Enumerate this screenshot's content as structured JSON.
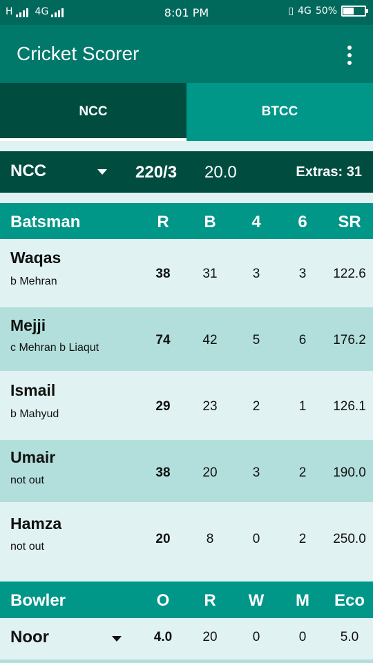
{
  "status_bar": {
    "network_left": "H",
    "network_mid": "4G",
    "time": "8:01 PM",
    "network_right": "4G",
    "battery": "50%",
    "battery_level": 0.5
  },
  "app": {
    "title": "Cricket Scorer",
    "menu_icon": "more-vert-icon"
  },
  "tabs": [
    {
      "label": "NCC",
      "active": true
    },
    {
      "label": "BTCC",
      "active": false
    }
  ],
  "innings": {
    "team": "NCC",
    "score": "220/3",
    "overs": "20.0",
    "extras": "Extras: 31"
  },
  "batting": {
    "headers": [
      "Batsman",
      "R",
      "B",
      "4",
      "6",
      "SR"
    ],
    "rows": [
      {
        "name": "Waqas",
        "dismissal": "b Mehran",
        "r": "38",
        "b": "31",
        "fours": "3",
        "sixes": "3",
        "sr": "122.6"
      },
      {
        "name": "Mejji",
        "dismissal": "c Mehran b Liaqut",
        "r": "74",
        "b": "42",
        "fours": "5",
        "sixes": "6",
        "sr": "176.2"
      },
      {
        "name": "Ismail",
        "dismissal": "b Mahyud",
        "r": "29",
        "b": "23",
        "fours": "2",
        "sixes": "1",
        "sr": "126.1"
      },
      {
        "name": "Umair",
        "dismissal": "not out",
        "r": "38",
        "b": "20",
        "fours": "3",
        "sixes": "2",
        "sr": "190.0"
      },
      {
        "name": "Hamza",
        "dismissal": "not out",
        "r": "20",
        "b": "8",
        "fours": "0",
        "sixes": "2",
        "sr": "250.0"
      }
    ]
  },
  "bowling": {
    "headers": [
      "Bowler",
      "O",
      "R",
      "W",
      "M",
      "Eco"
    ],
    "rows": [
      {
        "name": "Noor",
        "o": "4.0",
        "r": "20",
        "w": "0",
        "m": "0",
        "eco": "5.0"
      }
    ]
  },
  "colors": {
    "primary": "#00796b",
    "primary_dark": "#004d40",
    "status": "#00695c",
    "header": "#009688",
    "row_light": "#e0f2f1",
    "row_dark": "#b2dfdb"
  }
}
